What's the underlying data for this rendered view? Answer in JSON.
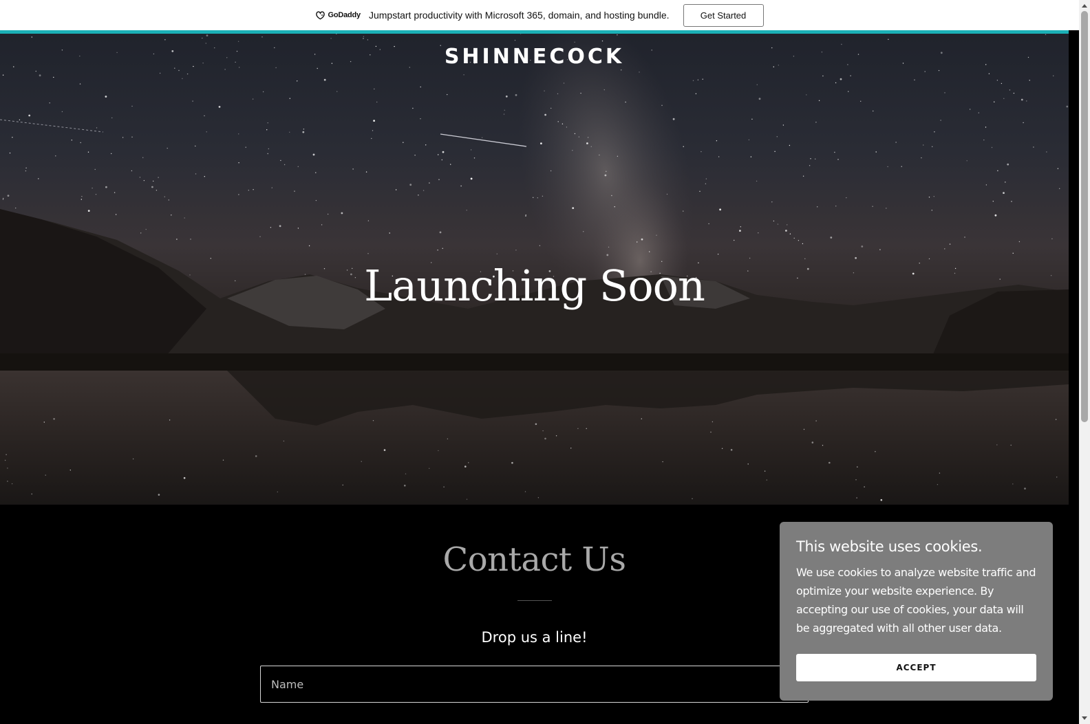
{
  "promo": {
    "logo_text": "GoDaddy",
    "message": "Jumpstart productivity with Microsoft 365, domain, and hosting bundle.",
    "button_label": "Get Started",
    "accent_color": "#1bb0b6"
  },
  "hero": {
    "brand": "SHINNECOCK",
    "title": "Launching Soon"
  },
  "contact": {
    "title": "Contact Us",
    "subtitle": "Drop us a line!",
    "name_placeholder": "Name"
  },
  "cookie": {
    "title": "This website uses cookies.",
    "body": "We use cookies to analyze website traffic and optimize your website experience. By accepting our use of cookies, your data will be aggregated with all other user data.",
    "button_label": "ACCEPT"
  },
  "icons": {
    "godaddy": "godaddy-logo-icon",
    "scroll_up": "scroll-up-arrow-icon",
    "scroll_down": "scroll-down-arrow-icon"
  }
}
